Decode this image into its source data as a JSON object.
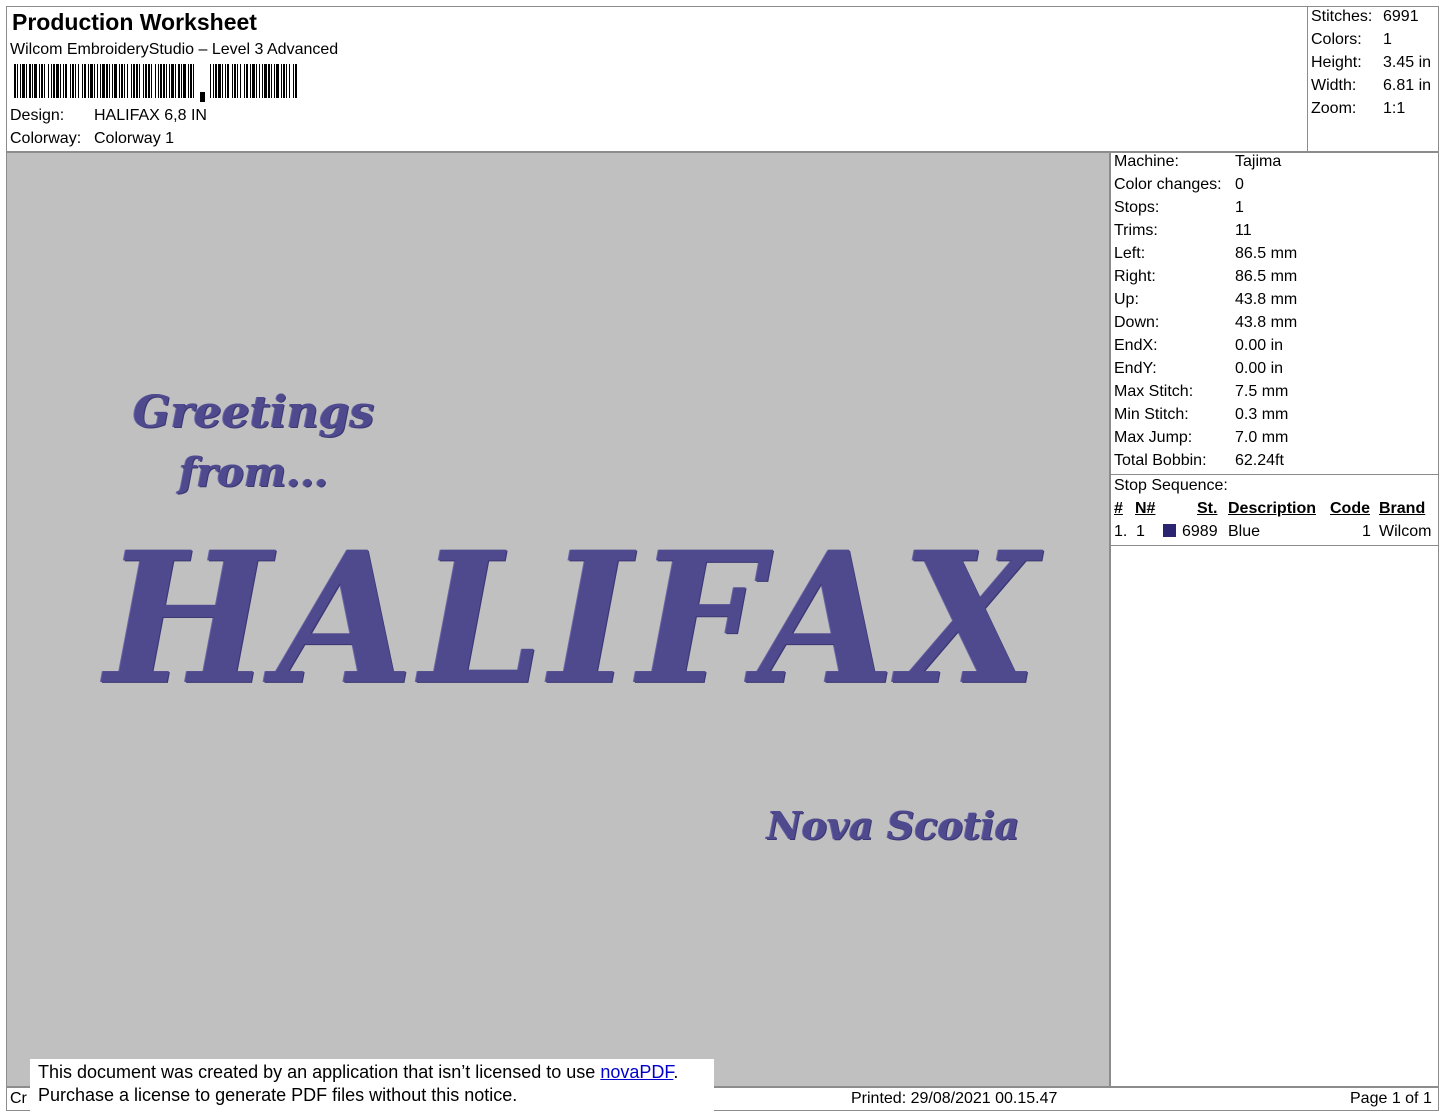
{
  "header": {
    "title": "Production Worksheet",
    "software": "Wilcom EmbroideryStudio – Level 3 Advanced",
    "design_label": "Design:",
    "design_value": "HALIFAX 6,8 IN",
    "colorway_label": "Colorway:",
    "colorway_value": "Colorway 1"
  },
  "summary": [
    {
      "label": "Stitches:",
      "value": "6991"
    },
    {
      "label": "Colors:",
      "value": "1"
    },
    {
      "label": "Height:",
      "value": "3.45 in"
    },
    {
      "label": "Width:",
      "value": "6.81 in"
    },
    {
      "label": "Zoom:",
      "value": "1:1"
    }
  ],
  "machine_info": [
    {
      "label": "Machine:",
      "value": "Tajima"
    },
    {
      "label": "Color changes:",
      "value": "0"
    },
    {
      "label": "Stops:",
      "value": "1"
    },
    {
      "label": "Trims:",
      "value": "11"
    },
    {
      "label": "Left:",
      "value": "86.5 mm"
    },
    {
      "label": "Right:",
      "value": "86.5 mm"
    },
    {
      "label": "Up:",
      "value": "43.8 mm"
    },
    {
      "label": "Down:",
      "value": "43.8 mm"
    },
    {
      "label": "EndX:",
      "value": "0.00 in"
    },
    {
      "label": "EndY:",
      "value": "0.00 in"
    },
    {
      "label": "Max Stitch:",
      "value": "7.5 mm"
    },
    {
      "label": "Min Stitch:",
      "value": "0.3 mm"
    },
    {
      "label": "Max Jump:",
      "value": "7.0 mm"
    },
    {
      "label": "Total Bobbin:",
      "value": "62.24ft"
    }
  ],
  "stop_sequence": {
    "label": "Stop Sequence:",
    "headers": {
      "num": "#",
      "n": "N#",
      "st": "St.",
      "description": "Description",
      "code": "Code",
      "brand": "Brand"
    },
    "rows": [
      {
        "num": "1.",
        "n": "1",
        "color": "#2b2470",
        "st": "6989",
        "description": "Blue",
        "code": "1",
        "brand": "Wilcom"
      }
    ]
  },
  "design_text": {
    "greetings": "Greetings",
    "from": "from...",
    "city": "HALIFAX",
    "province": "Nova Scotia"
  },
  "notice": {
    "line1_before": "This document was created by an application that isn’t licensed to use ",
    "link": "novaPDF",
    "line1_after": ".",
    "line2": "Purchase a license to generate PDF files without this notice."
  },
  "footer": {
    "left_fragment": "Cr",
    "printed": "Printed: 29/08/2021 00.15.47",
    "page": "Page 1 of 1"
  },
  "colors": {
    "design_background": "#c0c0c0",
    "thread": "#4f4a8e"
  }
}
